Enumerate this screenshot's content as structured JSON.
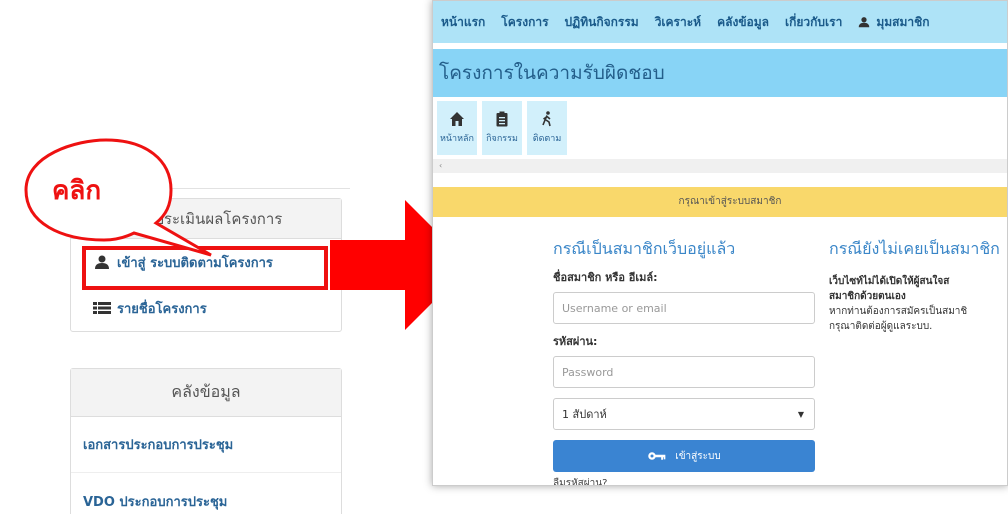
{
  "left": {
    "panel1": {
      "header": "-ประเมินผลโครงการ",
      "items": [
        {
          "label": "เข้าสู่ ระบบติดตามโครงการ",
          "icon": "user-icon"
        },
        {
          "label": "รายชื่อโครงการ",
          "icon": "list-icon"
        }
      ]
    },
    "panel2": {
      "header": "คลังข้อมูล",
      "items": [
        {
          "label": "เอกสารประกอบการประชุม"
        },
        {
          "label": "VDO ประกอบการประชุม"
        }
      ]
    }
  },
  "callout": {
    "text": "คลิก",
    "color": "#e11111"
  },
  "screenshot": {
    "nav": [
      "หน้าแรก",
      "โครงการ",
      "ปฏิทินกิจกรรม",
      "วิเคราะห์",
      "คลังข้อมูล",
      "เกี่ยวกับเรา"
    ],
    "member": "มุมสมาชิก",
    "project_title": "โครงการในความรับผิดชอบ",
    "icon_buttons": [
      {
        "label": "หน้าหลัก",
        "icon": "home-icon"
      },
      {
        "label": "กิจกรรม",
        "icon": "clipboard-icon"
      },
      {
        "label": "ติดตาม",
        "icon": "walking-icon"
      }
    ],
    "scroll_marker": "‹",
    "notice": "กรุณาเข้าสู่ระบบสมาชิก",
    "login": {
      "title": "กรณีเป็นสมาชิกเว็บอยู่แล้ว",
      "username_label": "ชื่อสมาชิก หรือ อีเมล์:",
      "username_placeholder": "Username or email",
      "password_label": "รหัสผ่าน:",
      "password_placeholder": "Password",
      "remember_value": "1 สัปดาห์",
      "button": "เข้าสู่ระบบ",
      "forgot": "ลืมรหัสผ่าน?"
    },
    "info": {
      "title": "กรณียังไม่เคยเป็นสมาชิก",
      "lines": [
        "เว็บไซท์ไม่ได้เปิดให้ผู้สนใจส",
        "สมาชิกด้วยตนเอง",
        "หากท่านต้องการสมัครเป็นสมาชิ",
        "กรุณาติดต่อผู้ดูแลระบบ."
      ]
    }
  },
  "colors": {
    "nav": "#aee3f7",
    "project_bar": "#88d4f6",
    "notice": "#f9d86b",
    "button": "#3a84d2",
    "highlight": "#e11111"
  }
}
